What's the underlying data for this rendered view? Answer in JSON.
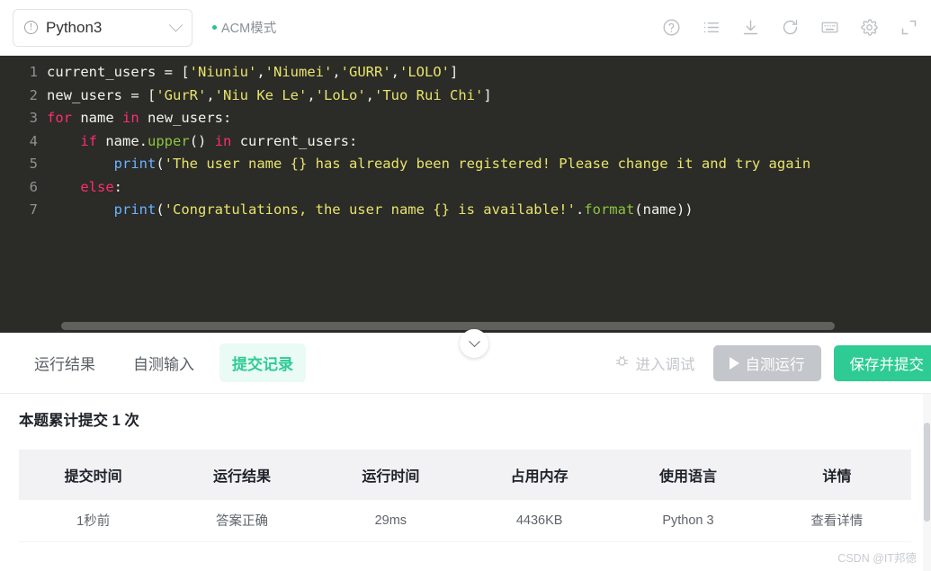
{
  "toolbar": {
    "language_select": {
      "value": "Python3",
      "warn_icon": "exclamation-circle-icon",
      "chevron": "chevron-down-icon"
    },
    "mode_label": "ACM模式",
    "icons": [
      {
        "name": "help-icon",
        "title": "帮助"
      },
      {
        "name": "list-icon",
        "title": "题目列表"
      },
      {
        "name": "download-icon",
        "title": "下载代码"
      },
      {
        "name": "refresh-icon",
        "title": "重置代码"
      },
      {
        "name": "keyboard-icon",
        "title": "快捷键"
      },
      {
        "name": "gear-icon",
        "title": "设置"
      },
      {
        "name": "expand-icon",
        "title": "全屏"
      }
    ]
  },
  "editor": {
    "lines": [
      {
        "num": "1",
        "text": "current_users = ['Niuniu','Niumei','GURR','LOLO']"
      },
      {
        "num": "2",
        "text": "new_users = ['GurR','Niu Ke Le','LoLo','Tuo Rui Chi']"
      },
      {
        "num": "3",
        "text": "for name in new_users:"
      },
      {
        "num": "4",
        "text": "    if name.upper() in current_users:"
      },
      {
        "num": "5",
        "text": "        print('The user name {} has already been registered! Please change it and try again"
      },
      {
        "num": "6",
        "text": "    else:"
      },
      {
        "num": "7",
        "text": "        print('Congratulations, the user name {} is available!'.format(name))"
      }
    ],
    "collapse_icon": "chevron-down-icon",
    "background": "#2b2b28",
    "colors": {
      "keyword": "#ff2d6f",
      "string": "#e8e46a",
      "function": "#6bb3ff",
      "method": "#8cc63f",
      "plain": "#f2f2ee",
      "line_number": "#8e938f"
    }
  },
  "tabs": [
    {
      "label": "运行结果",
      "active": false
    },
    {
      "label": "自测输入",
      "active": false
    },
    {
      "label": "提交记录",
      "active": true
    }
  ],
  "actions": {
    "debug_label": "进入调试",
    "debug_icon": "bug-icon",
    "run_label": "自测运行",
    "run_icon": "play-icon",
    "submit_label": "保存并提交"
  },
  "submissions": {
    "title": "本题累计提交 1 次",
    "columns": [
      "提交时间",
      "运行结果",
      "运行时间",
      "占用内存",
      "使用语言",
      "详情"
    ],
    "rows": [
      {
        "time": "1秒前",
        "result": "答案正确",
        "runtime": "29ms",
        "memory": "4436KB",
        "language": "Python 3",
        "detail": "查看详情"
      }
    ]
  },
  "watermark": "CSDN @IT邦德",
  "accent_color": "#2ecb95"
}
